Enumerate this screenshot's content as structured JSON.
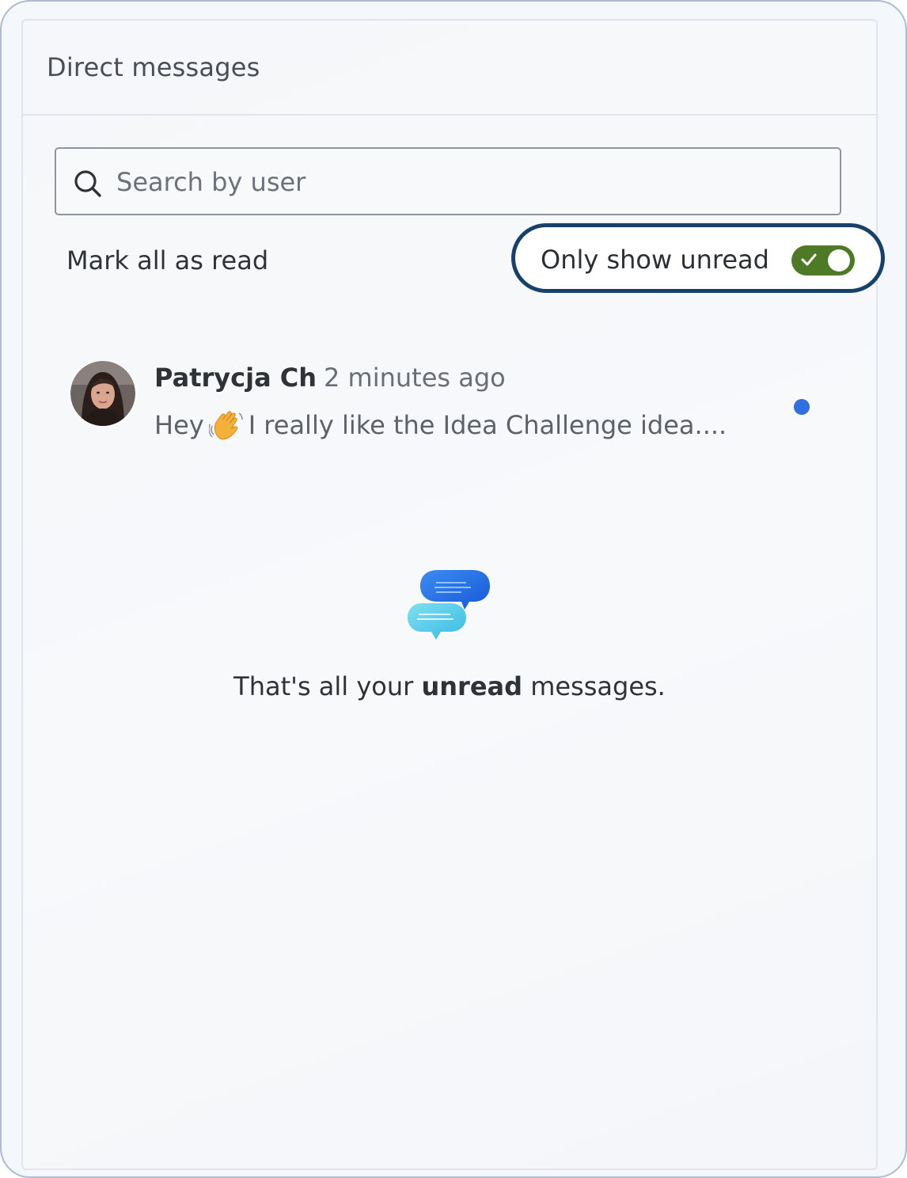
{
  "panel": {
    "title": "Direct messages"
  },
  "search": {
    "placeholder": "Search by user",
    "value": "",
    "icon": "search-icon"
  },
  "actions": {
    "mark_all_read": "Mark all as read",
    "only_unread_label": "Only show unread",
    "only_unread_on": true
  },
  "messages": [
    {
      "sender": "Patrycja Ch",
      "time": "2 minutes ago",
      "preview_before": "Hey",
      "preview_emoji": "waving-hand-icon",
      "preview_after": "I really like the Idea Challenge idea....",
      "unread": true
    }
  ],
  "empty_state": {
    "icon": "chat-bubbles-icon",
    "text_before": "That's all your",
    "text_bold": "unread",
    "text_after": "messages."
  },
  "colors": {
    "toggle_on": "#4f7a25",
    "focus_ring": "#17406b",
    "unread_dot": "#2f6fe0"
  }
}
